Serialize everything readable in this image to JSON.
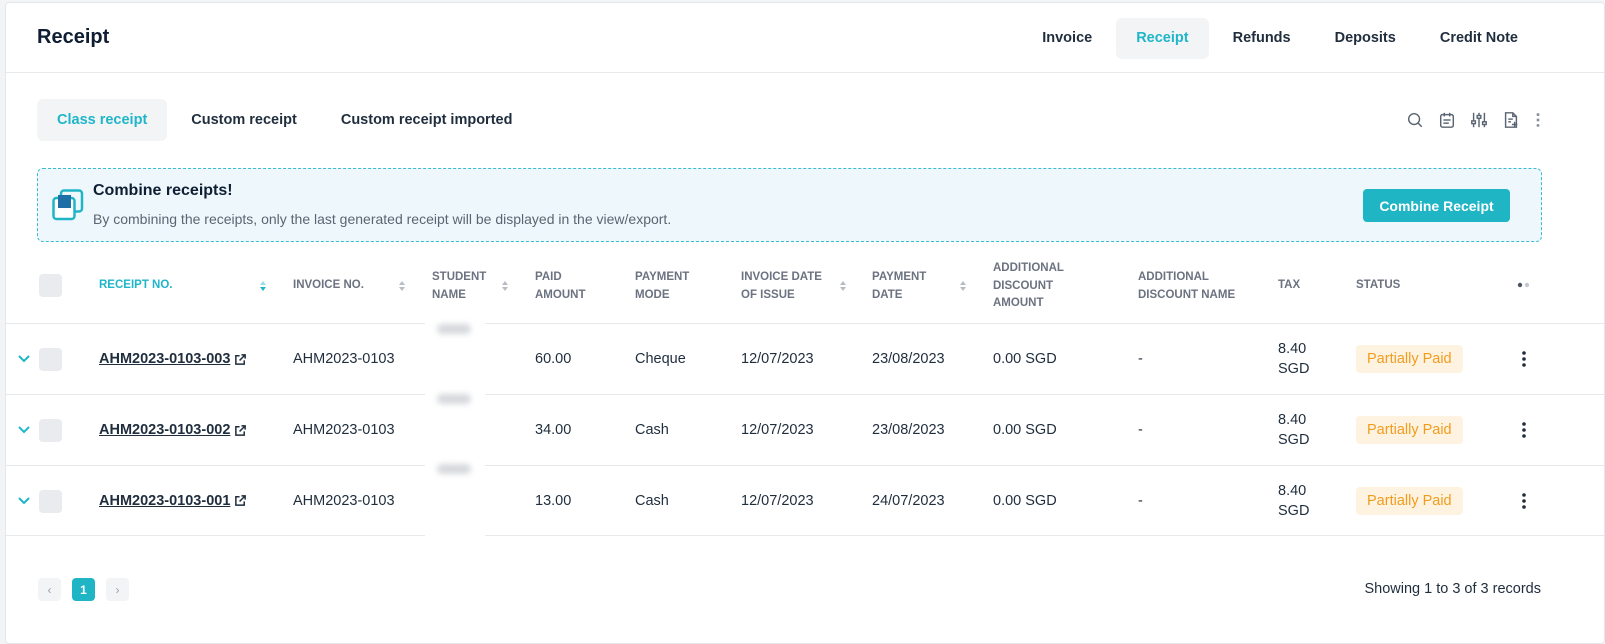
{
  "header": {
    "title": "Receipt",
    "tabs": [
      {
        "label": "Invoice",
        "active": false
      },
      {
        "label": "Receipt",
        "active": true
      },
      {
        "label": "Refunds",
        "active": false
      },
      {
        "label": "Deposits",
        "active": false
      },
      {
        "label": "Credit Note",
        "active": false
      }
    ]
  },
  "subtabs": [
    {
      "label": "Class receipt",
      "active": true
    },
    {
      "label": "Custom receipt",
      "active": false
    },
    {
      "label": "Custom receipt imported",
      "active": false
    }
  ],
  "toolbar": {
    "icons": [
      "search-icon",
      "calendar-icon",
      "filter-sliders-icon",
      "export-document-icon",
      "more-vertical-icon"
    ]
  },
  "banner": {
    "title": "Combine receipts!",
    "text": "By combining the receipts, only the last generated receipt will be displayed in the view/export.",
    "button_label": "Combine Receipt"
  },
  "table": {
    "columns": {
      "receipt_no": "RECEIPT NO.",
      "invoice_no": "INVOICE NO.",
      "student_name_1": "STUDENT",
      "student_name_2": "NAME",
      "paid_amount_1": "PAID",
      "paid_amount_2": "AMOUNT",
      "payment_mode_1": "PAYMENT",
      "payment_mode_2": "MODE",
      "invoice_date_1": "INVOICE DATE",
      "invoice_date_2": "OF ISSUE",
      "payment_date_1": "PAYMENT",
      "payment_date_2": "DATE",
      "add_disc_amount_1": "ADDITIONAL",
      "add_disc_amount_2": "DISCOUNT",
      "add_disc_amount_3": "AMOUNT",
      "add_disc_name_1": "ADDITIONAL",
      "add_disc_name_2": "DISCOUNT NAME",
      "tax": "TAX",
      "status": "STATUS"
    },
    "rows": [
      {
        "receipt_no": "AHM2023-0103-003",
        "invoice_no": "AHM2023-0103",
        "paid_amount": "60.00",
        "payment_mode": "Cheque",
        "invoice_date": "12/07/2023",
        "payment_date": "23/08/2023",
        "add_disc_amount": "0.00 SGD",
        "add_disc_name": "-",
        "tax_value": "8.40",
        "tax_currency": "SGD",
        "status": "Partially Paid"
      },
      {
        "receipt_no": "AHM2023-0103-002",
        "invoice_no": "AHM2023-0103",
        "paid_amount": "34.00",
        "payment_mode": "Cash",
        "invoice_date": "12/07/2023",
        "payment_date": "23/08/2023",
        "add_disc_amount": "0.00 SGD",
        "add_disc_name": "-",
        "tax_value": "8.40",
        "tax_currency": "SGD",
        "status": "Partially Paid"
      },
      {
        "receipt_no": "AHM2023-0103-001",
        "invoice_no": "AHM2023-0103",
        "paid_amount": "13.00",
        "payment_mode": "Cash",
        "invoice_date": "12/07/2023",
        "payment_date": "24/07/2023",
        "add_disc_amount": "0.00 SGD",
        "add_disc_name": "-",
        "tax_value": "8.40",
        "tax_currency": "SGD",
        "status": "Partially Paid"
      }
    ]
  },
  "pagination": {
    "prev": "‹",
    "current_page": "1",
    "next": "›",
    "summary": "Showing 1 to 3 of 3 records"
  },
  "colors": {
    "accent": "#20b5c5",
    "status_partial_bg": "#fdf3e0",
    "status_partial_text": "#f29c1f"
  }
}
